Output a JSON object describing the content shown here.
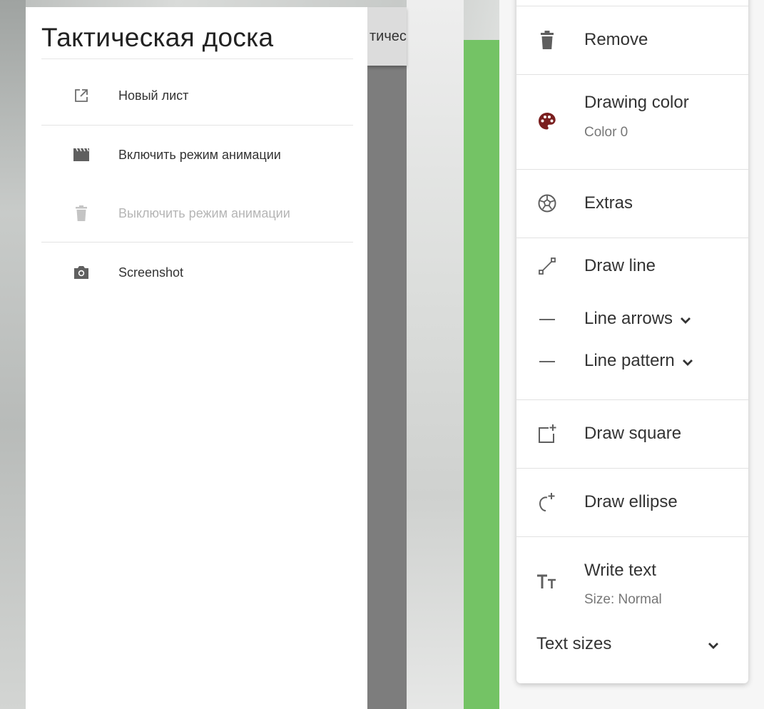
{
  "drawer": {
    "title": "Тактическая доска",
    "items": [
      {
        "label": "Новый лист",
        "icon": "open-in-new-icon",
        "disabled": false
      },
      {
        "label": "Включить режим анимации",
        "icon": "movie-icon",
        "disabled": false
      },
      {
        "label": "Выключить режим анимации",
        "icon": "delete-icon",
        "disabled": true
      },
      {
        "label": "Screenshot",
        "icon": "camera-icon",
        "disabled": false
      }
    ]
  },
  "background": {
    "partial_title": "тичес"
  },
  "menu": {
    "remove": {
      "label": "Remove",
      "icon": "delete-icon"
    },
    "drawing_color": {
      "label": "Drawing color",
      "value": "Color 0",
      "icon": "palette-icon",
      "color": "#7a1f1f"
    },
    "extras": {
      "label": "Extras",
      "icon": "soccer-ball-icon"
    },
    "draw_line": {
      "label": "Draw line",
      "icon": "draw-line-icon"
    },
    "line_arrows": {
      "label": "Line arrows",
      "icon": "dash-icon"
    },
    "line_pattern": {
      "label": "Line pattern",
      "icon": "dash-icon"
    },
    "draw_square": {
      "label": "Draw square",
      "icon": "add-square-icon"
    },
    "draw_ellipse": {
      "label": "Draw ellipse",
      "icon": "add-ellipse-icon"
    },
    "write_text": {
      "label": "Write text",
      "value": "Size: Normal",
      "icon": "text-size-icon"
    },
    "text_sizes": {
      "label": "Text sizes"
    }
  },
  "colors": {
    "green": "#74c365",
    "palette": "#7a1f1f"
  }
}
